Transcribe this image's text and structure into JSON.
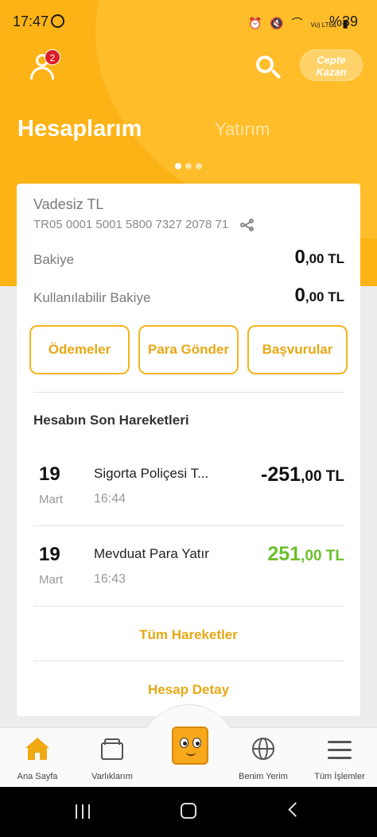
{
  "status_bar": {
    "time": "17:47",
    "battery": "%39",
    "network": "Vo) LTE1"
  },
  "header": {
    "notification_count": "2",
    "cepte_kazan_line1": "Cepte",
    "cepte_kazan_line2": "Kazan",
    "tabs": [
      {
        "label": "Hesaplarım",
        "active": true
      },
      {
        "label": "Yatırım",
        "active": false
      }
    ],
    "carousel_page": 1,
    "carousel_total": 3
  },
  "account": {
    "name": "Vadesiz TL",
    "iban": "TR05 0001 5001 5800 7327 2078 71",
    "balance_label": "Bakiye",
    "balance_int": "0",
    "balance_dec": ",00 TL",
    "available_label": "Kullanılabilir Bakiye",
    "available_int": "0",
    "available_dec": ",00 TL"
  },
  "actions": [
    "Ödemeler",
    "Para Gönder",
    "Başvurular"
  ],
  "transactions_title": "Hesabın Son Hareketleri",
  "transactions": [
    {
      "day": "19",
      "month": "Mart",
      "description": "Sigorta Poliçesi T...",
      "time": "16:44",
      "amount_int": "-251",
      "amount_dec": ",00 TL",
      "direction": "out"
    },
    {
      "day": "19",
      "month": "Mart",
      "description": "Mevduat Para Yatır",
      "time": "16:43",
      "amount_int": "251",
      "amount_dec": ",00 TL",
      "direction": "in"
    }
  ],
  "links": {
    "all_transactions": "Tüm Hareketler",
    "account_detail": "Hesap Detay"
  },
  "bottom_nav": [
    {
      "label": "Ana Sayfa",
      "icon": "home-icon",
      "active": true
    },
    {
      "label": "Varlıklarım",
      "icon": "wallet-icon",
      "active": false
    },
    {
      "label": "",
      "icon": "mascot-icon",
      "active": false
    },
    {
      "label": "Benim Yerim",
      "icon": "globe-user-icon",
      "active": false
    },
    {
      "label": "Tüm İşlemler",
      "icon": "menu-icon",
      "active": false
    }
  ],
  "colors": {
    "brand": "#fcb315",
    "accent_text": "#e8a815",
    "positive": "#6cc02d",
    "badge": "#d91f2a"
  }
}
